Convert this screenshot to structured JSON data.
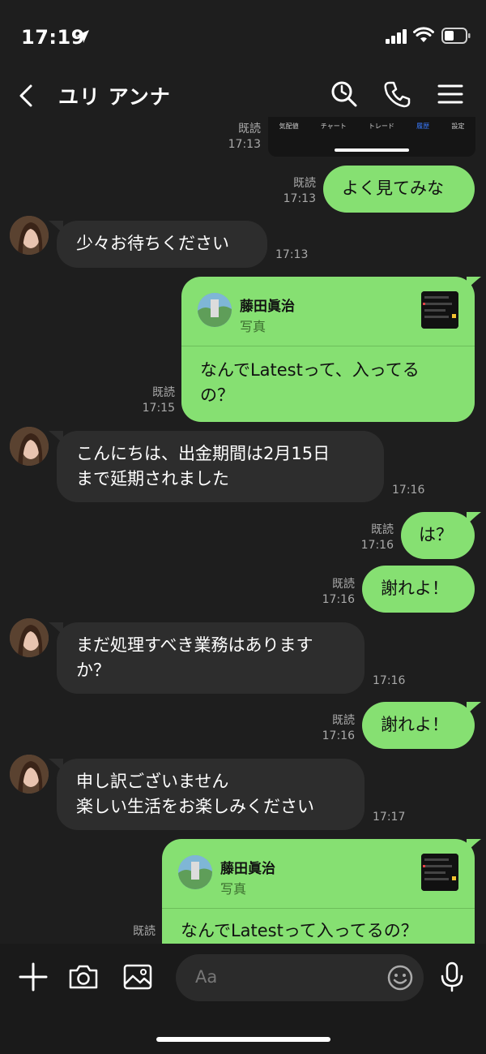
{
  "status_bar": {
    "time": "17:19"
  },
  "header": {
    "contact_name": "ユリ アンナ"
  },
  "shared_screenshot": {
    "tabs": [
      "気配値",
      "チャート",
      "トレード",
      "履歴",
      "設定"
    ]
  },
  "messages": [
    {
      "dir": "out",
      "text": "よく見てみな",
      "read": "既読",
      "time": "17:13"
    },
    {
      "dir": "in",
      "lines": [
        "少々お待ちください"
      ],
      "time": "17:13"
    },
    {
      "dir": "out",
      "reply_name": "藤田眞治",
      "reply_type": "写真",
      "lines": [
        "なんでLatestって、入ってる",
        "の？"
      ],
      "read": "既読",
      "time": "17:15"
    },
    {
      "dir": "in",
      "lines": [
        "こんにちは、出金期間は2月15日",
        "まで延期されました"
      ],
      "time": "17:16"
    },
    {
      "dir": "out",
      "text": "は？",
      "read": "既読",
      "time": "17:16"
    },
    {
      "dir": "out",
      "text": "謝れよ！",
      "read": "既読",
      "time": "17:16"
    },
    {
      "dir": "in",
      "lines": [
        "まだ処理すべき業務はあります",
        "か？"
      ],
      "time": "17:16"
    },
    {
      "dir": "out",
      "text": "謝れよ！",
      "read": "既読",
      "time": "17:16"
    },
    {
      "dir": "in",
      "lines": [
        "申し訳ございません",
        "楽しい生活をお楽しみください"
      ],
      "time": "17:17"
    },
    {
      "dir": "out",
      "reply_name": "藤田眞治",
      "reply_type": "写真",
      "lines": [
        "なんでLatestって入ってるの？"
      ],
      "read": "既読"
    }
  ],
  "first_msg_meta": {
    "read": "既読",
    "time": "17:13"
  },
  "input": {
    "placeholder": "Aa"
  },
  "colors": {
    "outgoing": "#86e072",
    "incoming": "#2d2d2d",
    "background": "#1e1e1e"
  }
}
